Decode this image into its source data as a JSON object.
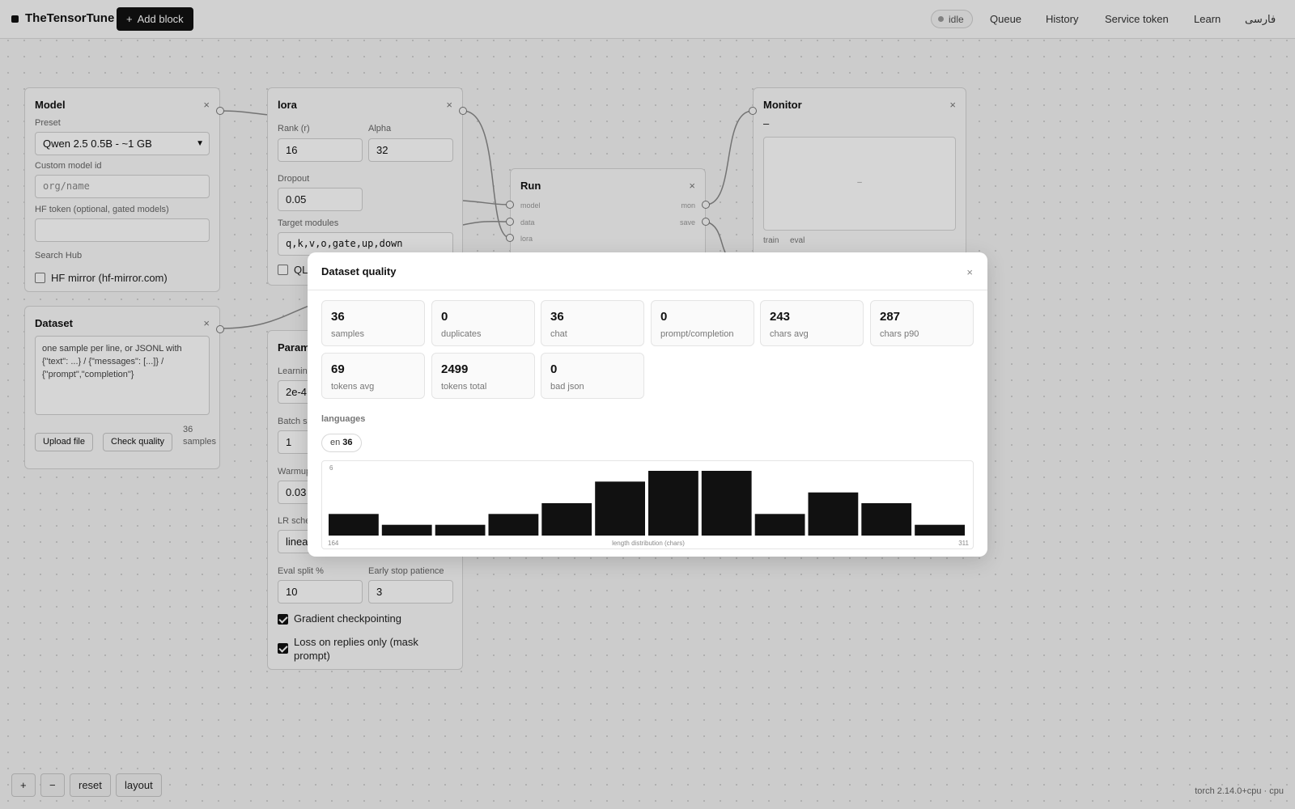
{
  "app": {
    "title": "TheTensorTune",
    "add_block": "Add block"
  },
  "header": {
    "status": "idle",
    "nav": [
      "Queue",
      "History",
      "Service token",
      "Learn",
      "فارسی"
    ]
  },
  "blocks": {
    "model": {
      "title": "Model",
      "preset_label": "Preset",
      "preset_value": "Qwen 2.5 0.5B - ~1 GB",
      "custom_label": "Custom model id",
      "custom_placeholder": "org/name",
      "hf_token_label": "HF token (optional, gated models)",
      "hf_token_value": "",
      "search_hub": "Search Hub",
      "mirror_label": "HF mirror (hf-mirror.com)",
      "mirror_checked": false
    },
    "lora": {
      "title": "lora",
      "rank_label": "Rank (r)",
      "rank_value": "16",
      "alpha_label": "Alpha",
      "alpha_value": "32",
      "dropout_label": "Dropout",
      "dropout_value": "0.05",
      "target_label": "Target modules",
      "target_value": "q,k,v,o,gate,up,down",
      "qlora_label": "QL"
    },
    "dataset": {
      "title": "Dataset",
      "placeholder": "one sample per line, or JSONL with {\"text\": ...} / {\"messages\": [...]} / {\"prompt\",\"completion\"}",
      "upload": "Upload file",
      "check": "Check quality",
      "count": "36 samples"
    },
    "params": {
      "title": "Param",
      "lr_label": "Learnin",
      "lr_value": "2e-4",
      "batch_label": "Batch s",
      "batch_value": "1",
      "warmup_label": "Warmup",
      "warmup_value": "0.03",
      "sched_label": "LR sche",
      "sched_value": "linea",
      "eval_label": "Eval split %",
      "eval_value": "10",
      "patience_label": "Early stop patience",
      "patience_value": "3",
      "grad_ckpt_label": "Gradient checkpointing",
      "mask_label": "Loss on replies only (mask prompt)"
    },
    "run": {
      "title": "Run",
      "inputs": [
        "model",
        "data",
        "lora"
      ],
      "outputs": [
        "mon",
        "save"
      ]
    },
    "monitor": {
      "title": "Monitor",
      "value": "–",
      "empty": "–",
      "tabs": [
        "train",
        "eval"
      ]
    }
  },
  "modal": {
    "title": "Dataset quality",
    "stats": [
      {
        "value": "36",
        "label": "samples"
      },
      {
        "value": "0",
        "label": "duplicates"
      },
      {
        "value": "36",
        "label": "chat"
      },
      {
        "value": "0",
        "label": "prompt/completion"
      },
      {
        "value": "243",
        "label": "chars avg"
      },
      {
        "value": "287",
        "label": "chars p90"
      },
      {
        "value": "69",
        "label": "tokens avg"
      },
      {
        "value": "2499",
        "label": "tokens total"
      },
      {
        "value": "0",
        "label": "bad json"
      }
    ],
    "languages_heading": "languages",
    "language": {
      "code": "en",
      "count": "36"
    }
  },
  "chart_data": {
    "type": "bar",
    "title": "",
    "xlabel": "length distribution (chars)",
    "ylabel": "",
    "x_min_label": "164",
    "x_max_label": "311",
    "y_max_label": "6",
    "ylim": [
      0,
      6
    ],
    "values": [
      2,
      1,
      1,
      2,
      3,
      5,
      6,
      6,
      2,
      4,
      3,
      1
    ]
  },
  "bottom": {
    "zoom_in": "+",
    "zoom_out": "−",
    "reset": "reset",
    "layout": "layout",
    "torch_info": "torch 2.14.0+cpu · cpu"
  },
  "colors": {
    "accent": "#111111",
    "bar": "#111111",
    "overlay": "#000000"
  }
}
